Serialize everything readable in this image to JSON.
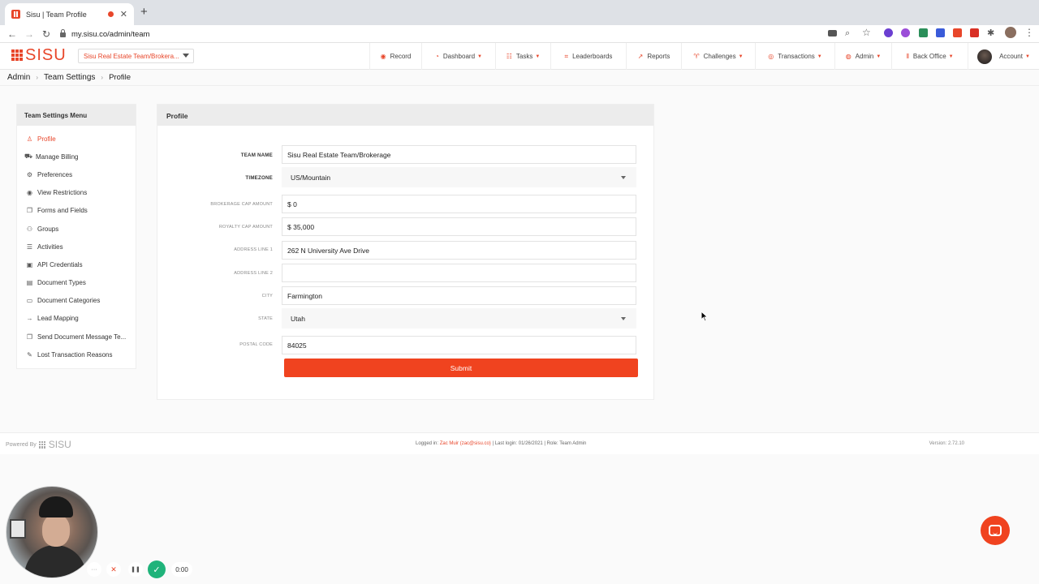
{
  "browser": {
    "tab_title": "Sisu | Team Profile",
    "tab_close": "✕",
    "new_tab": "+",
    "url": "my.sisu.co/admin/team"
  },
  "app": {
    "logo_text": "SISU",
    "team_selector": "Sisu Real Estate Team/Brokera...",
    "nav": [
      {
        "label": "Record",
        "icon": "record-icon",
        "glyph": "◉",
        "dropdown": false
      },
      {
        "label": "Dashboard",
        "icon": "dashboard-icon",
        "glyph": "◔",
        "dropdown": true
      },
      {
        "label": "Tasks",
        "icon": "tasks-icon",
        "glyph": "☷",
        "dropdown": true
      },
      {
        "label": "Leaderboards",
        "icon": "leaderboard-icon",
        "glyph": "⌗",
        "dropdown": false
      },
      {
        "label": "Reports",
        "icon": "reports-icon",
        "glyph": "↗",
        "dropdown": false
      },
      {
        "label": "Challenges",
        "icon": "trophy-icon",
        "glyph": "♈",
        "dropdown": true
      },
      {
        "label": "Transactions",
        "icon": "transactions-icon",
        "glyph": "◎",
        "dropdown": true
      },
      {
        "label": "Admin",
        "icon": "admin-icon",
        "glyph": "◍",
        "dropdown": true
      },
      {
        "label": "Back Office",
        "icon": "back-office-icon",
        "glyph": "⦀",
        "dropdown": true
      },
      {
        "label": "Account",
        "icon": "avatar",
        "glyph": "",
        "dropdown": true
      }
    ],
    "accent_color": "#e8462a"
  },
  "breadcrumb": {
    "items": [
      "Admin",
      "Team Settings",
      "Profile"
    ],
    "separator": "›"
  },
  "side_menu": {
    "title": "Team Settings Menu",
    "items": [
      {
        "label": "Profile",
        "icon": "user-icon",
        "glyph": "♙",
        "active": true
      },
      {
        "label": "Manage Billing",
        "icon": "cart-icon",
        "glyph": "⛟",
        "active": false
      },
      {
        "label": "Preferences",
        "icon": "gear-icon",
        "glyph": "⚙",
        "active": false
      },
      {
        "label": "View Restrictions",
        "icon": "eye-icon",
        "glyph": "◉",
        "active": false
      },
      {
        "label": "Forms and Fields",
        "icon": "copy-icon",
        "glyph": "❐",
        "active": false
      },
      {
        "label": "Groups",
        "icon": "users-icon",
        "glyph": "⚇",
        "active": false
      },
      {
        "label": "Activities",
        "icon": "list-icon",
        "glyph": "☰",
        "active": false
      },
      {
        "label": "API Credentials",
        "icon": "api-icon",
        "glyph": "▣",
        "active": false
      },
      {
        "label": "Document Types",
        "icon": "document-icon",
        "glyph": "▤",
        "active": false
      },
      {
        "label": "Document Categories",
        "icon": "folder-icon",
        "glyph": "▭",
        "active": false
      },
      {
        "label": "Lead Mapping",
        "icon": "arrow-right-icon",
        "glyph": "→",
        "active": false
      },
      {
        "label": "Send Document Message Te...",
        "icon": "copy-icon",
        "glyph": "❐",
        "active": false
      },
      {
        "label": "Lost Transaction Reasons",
        "icon": "pencil-icon",
        "glyph": "✎",
        "active": false
      }
    ]
  },
  "profile": {
    "title": "Profile",
    "fields": {
      "team_name": {
        "label": "TEAM NAME",
        "value": "Sisu Real Estate Team/Brokerage"
      },
      "timezone": {
        "label": "TIMEZONE",
        "value": "US/Mountain"
      },
      "brokerage_cap": {
        "label": "BROKERAGE CAP AMOUNT",
        "value": "$ 0"
      },
      "royalty_cap": {
        "label": "ROYALTY CAP AMOUNT",
        "value": "$ 35,000"
      },
      "address1": {
        "label": "ADDRESS LINE 1",
        "value": "262 N University Ave Drive"
      },
      "address2": {
        "label": "ADDRESS LINE 2",
        "value": ""
      },
      "city": {
        "label": "CITY",
        "value": "Farmington"
      },
      "state": {
        "label": "STATE",
        "value": "Utah"
      },
      "postal": {
        "label": "POSTAL CODE",
        "value": "84025"
      }
    },
    "submit_label": "Submit"
  },
  "footer": {
    "powered_by": "Powered By",
    "powered_logo": "SISU",
    "logged_in_prefix": "Logged in:",
    "user": "Zac Muir (zac@sisu.co)",
    "last_login": "| Last login: 01/26/2021 | Role: Team Admin",
    "version": "Version: 2.72.10"
  },
  "recorder": {
    "more": "···",
    "cancel": "✕",
    "pause": "❚❚",
    "done": "✓",
    "time": "0:00"
  }
}
